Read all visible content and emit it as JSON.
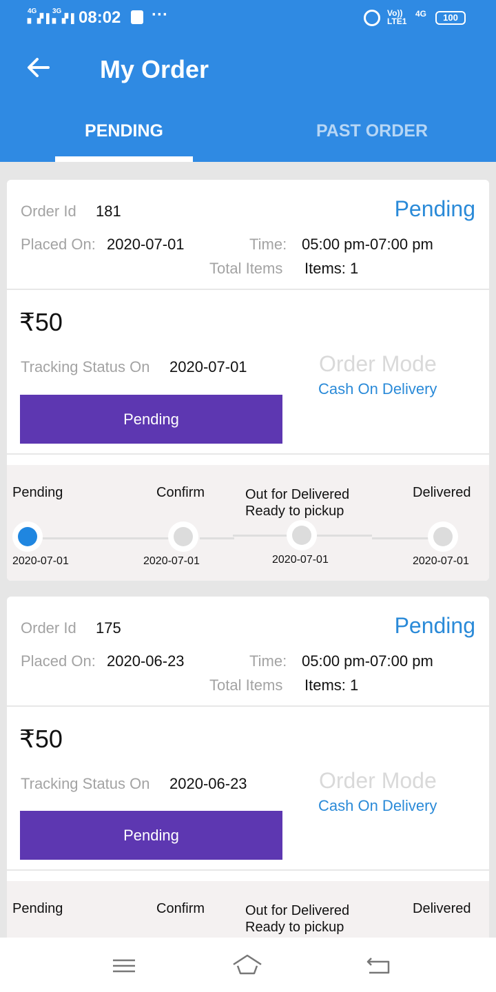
{
  "status_bar": {
    "sig1_type": "4G",
    "sig2_type": "3G",
    "time": "08:02",
    "volte": "Vo)) LTE1",
    "net": "4G",
    "battery": "100"
  },
  "header": {
    "title": "My Order",
    "tabs": [
      {
        "label": "PENDING",
        "active": true
      },
      {
        "label": "PAST ORDER",
        "active": false
      }
    ]
  },
  "labels": {
    "order_id": "Order Id",
    "placed_on": "Placed On:",
    "time": "Time:",
    "total_items": "Total Items",
    "tracking_status_on": "Tracking Status On",
    "order_mode": "Order Mode"
  },
  "orders": [
    {
      "order_id": "181",
      "status": "Pending",
      "placed_on": "2020-07-01",
      "time": "05:00 pm-07:00 pm",
      "items": "Items: 1",
      "amount": "₹50",
      "tracking_date": "2020-07-01",
      "payment_mode": "Cash On Delivery",
      "button_label": "Pending",
      "stages": [
        {
          "label": "Pending",
          "date": "2020-07-01",
          "active": true
        },
        {
          "label": "Confirm",
          "date": "2020-07-01",
          "active": false
        },
        {
          "label": "Out for Delivered\nReady to pickup",
          "date": "2020-07-01",
          "active": false
        },
        {
          "label": "Delivered",
          "date": "2020-07-01",
          "active": false
        }
      ]
    },
    {
      "order_id": "175",
      "status": "Pending",
      "placed_on": "2020-06-23",
      "time": "05:00 pm-07:00 pm",
      "items": "Items: 1",
      "amount": "₹50",
      "tracking_date": "2020-06-23",
      "payment_mode": "Cash On Delivery",
      "button_label": "Pending",
      "stages": [
        {
          "label": "Pending"
        },
        {
          "label": "Confirm"
        },
        {
          "label": "Out for Delivered\nReady to pickup"
        },
        {
          "label": "Delivered"
        }
      ]
    }
  ],
  "colors": {
    "app_bar": "#2f8ae3",
    "accent_blue": "#2a8ad8",
    "button_purple": "#5d37b1",
    "active_dot": "#1f86e0"
  },
  "nav_icons": [
    "menu-icon",
    "home-icon",
    "back-nav-icon"
  ]
}
